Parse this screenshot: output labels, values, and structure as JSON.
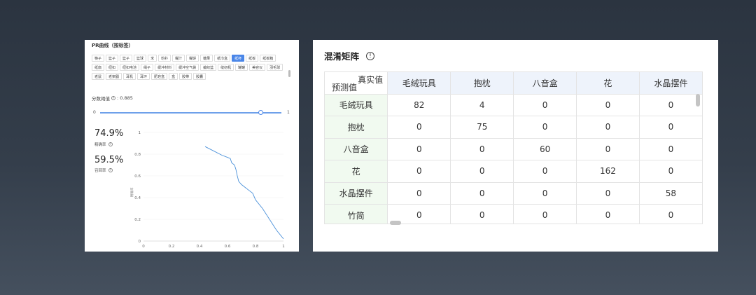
{
  "pr_panel": {
    "title": "PR曲线（按标签）",
    "tags": [
      {
        "label": "筷子",
        "active": false
      },
      {
        "label": "篮子",
        "active": false
      },
      {
        "label": "篮子",
        "active": false
      },
      {
        "label": "篮球",
        "active": false
      },
      {
        "label": "米",
        "active": false
      },
      {
        "label": "粉扑",
        "active": false
      },
      {
        "label": "糊汁",
        "active": false
      },
      {
        "label": "糊饼",
        "active": false
      },
      {
        "label": "糖果",
        "active": false
      },
      {
        "label": "纸巾盒",
        "active": false
      },
      {
        "label": "纸杯",
        "active": true
      },
      {
        "label": "纸板",
        "active": false
      },
      {
        "label": "纸板箱",
        "active": false
      },
      {
        "label": "纸扇",
        "active": false
      },
      {
        "label": "纽扣",
        "active": false
      },
      {
        "label": "纽扣电池",
        "active": false
      },
      {
        "label": "绳子",
        "active": false
      },
      {
        "label": "缓冲材料",
        "active": false
      },
      {
        "label": "缓冲空气袋",
        "active": false
      },
      {
        "label": "编织篮",
        "active": false
      },
      {
        "label": "缝纫机",
        "active": false
      },
      {
        "label": "罐罐",
        "active": false
      },
      {
        "label": "美容仪",
        "active": false
      },
      {
        "label": "羽毛球",
        "active": false
      },
      {
        "label": "老鼠",
        "active": false
      },
      {
        "label": "老架器",
        "active": false
      },
      {
        "label": "耳机",
        "active": false
      },
      {
        "label": "耳环",
        "active": false
      },
      {
        "label": "肥皂盒",
        "active": false
      },
      {
        "label": "盒",
        "active": false
      },
      {
        "label": "胶带",
        "active": false
      },
      {
        "label": "胶囊",
        "active": false
      }
    ],
    "threshold_label": "分数阈值",
    "threshold_value": ": 0.885",
    "slider_min": "0",
    "slider_max": "1",
    "slider_value": 0.885,
    "precision_value": "74.9%",
    "precision_label": "精确率",
    "recall_value": "59.5%",
    "recall_label": "召回率"
  },
  "chart_data": {
    "type": "line",
    "title": "",
    "xlabel": "",
    "ylabel": "精确率",
    "xlim": [
      0,
      1
    ],
    "ylim": [
      0,
      1
    ],
    "x_ticks": [
      "0",
      "0.2",
      "0.4",
      "0.6",
      "0.8",
      "1"
    ],
    "y_ticks": [
      "0",
      "0.2",
      "0.4",
      "0.6",
      "0.8",
      "1"
    ],
    "series": [
      {
        "color": "#4a90d9",
        "x": [
          0.44,
          0.5,
          0.56,
          0.6,
          0.62,
          0.63,
          0.65,
          0.66,
          0.67,
          0.68,
          0.7,
          0.72,
          0.75,
          0.78,
          0.8,
          0.85,
          0.9,
          0.95,
          1.0
        ],
        "y": [
          0.87,
          0.83,
          0.79,
          0.77,
          0.76,
          0.72,
          0.7,
          0.66,
          0.6,
          0.55,
          0.52,
          0.5,
          0.47,
          0.44,
          0.38,
          0.3,
          0.2,
          0.1,
          0.02
        ]
      }
    ]
  },
  "confusion_matrix": {
    "title": "混淆矩阵",
    "info_icon": "info-icon",
    "corner_top": "真实值",
    "corner_bottom": "预测值",
    "columns": [
      "毛绒玩具",
      "抱枕",
      "八音盒",
      "花",
      "水晶摆件"
    ],
    "rows": [
      {
        "label": "毛绒玩具",
        "values": [
          "82",
          "4",
          "0",
          "0",
          "0"
        ]
      },
      {
        "label": "抱枕",
        "values": [
          "0",
          "75",
          "0",
          "0",
          "0"
        ]
      },
      {
        "label": "八音盒",
        "values": [
          "0",
          "0",
          "60",
          "0",
          "0"
        ]
      },
      {
        "label": "花",
        "values": [
          "0",
          "0",
          "0",
          "162",
          "0"
        ]
      },
      {
        "label": "水晶摆件",
        "values": [
          "0",
          "0",
          "0",
          "0",
          "58"
        ]
      },
      {
        "label": "竹简",
        "values": [
          "0",
          "0",
          "0",
          "0",
          "0"
        ]
      }
    ]
  }
}
